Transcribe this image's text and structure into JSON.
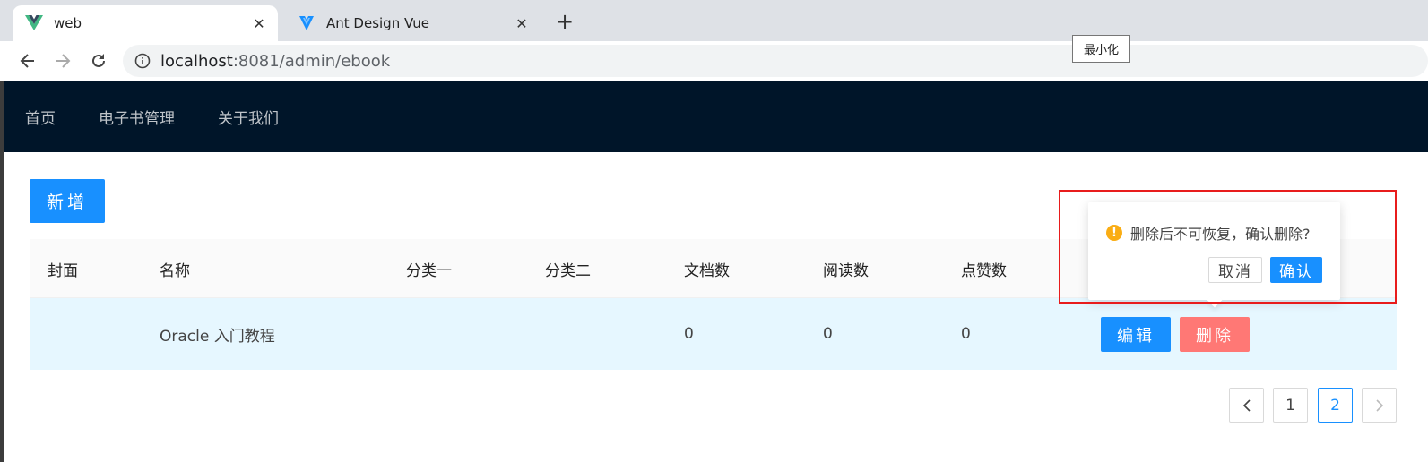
{
  "browser": {
    "tabs": [
      {
        "title": "web",
        "favicon": "vue-logo-icon",
        "active": true
      },
      {
        "title": "Ant Design Vue",
        "favicon": "ant-design-logo-icon",
        "active": false
      }
    ],
    "url_host": "localhost",
    "url_rest": ":8081/admin/ebook",
    "tooltip": "最小化"
  },
  "header": {
    "menu": [
      "首页",
      "电子书管理",
      "关于我们"
    ]
  },
  "actions": {
    "add": "新增"
  },
  "table": {
    "columns": [
      "封面",
      "名称",
      "分类一",
      "分类二",
      "文档数",
      "阅读数",
      "点赞数"
    ],
    "rows": [
      {
        "cover": "",
        "name": "Oracle 入门教程",
        "category1": "",
        "category2": "",
        "docs": "0",
        "views": "0",
        "likes": "0",
        "edit": "编辑",
        "delete": "删除"
      }
    ]
  },
  "popconfirm": {
    "message": "删除后不可恢复，确认删除?",
    "cancel": "取消",
    "ok": "确认"
  },
  "pagination": {
    "prev": "<",
    "pages": [
      "1",
      "2"
    ],
    "current": "2",
    "next": ">"
  },
  "colors": {
    "primary": "#1890ff",
    "danger": "#ff7875",
    "header_bg": "#001529",
    "row_highlight": "#e6f7ff",
    "warning": "#faad14"
  }
}
